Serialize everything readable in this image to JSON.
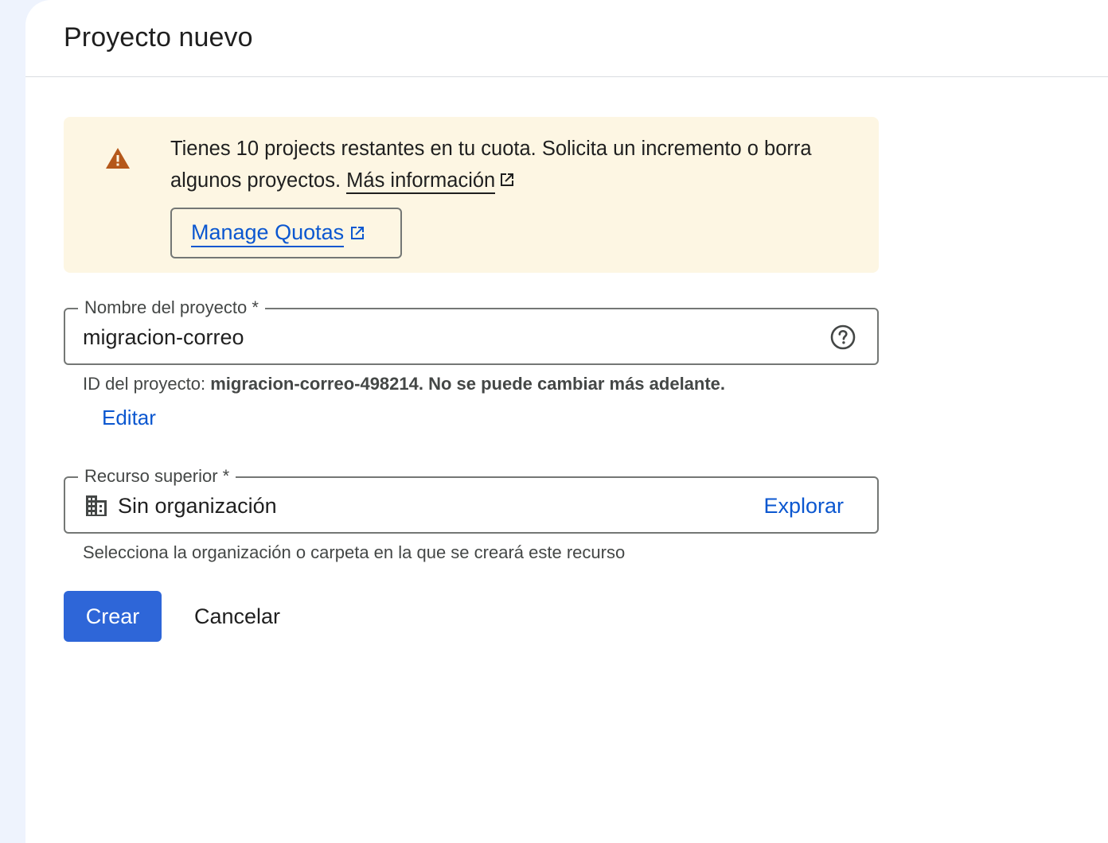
{
  "header": {
    "title": "Proyecto nuevo"
  },
  "banner": {
    "message": "Tienes 10 projects restantes en tu cuota. Solicita un incremento o borra algunos proyectos.",
    "more_info_link": "Más información",
    "manage_button": "Manage Quotas",
    "icon": "warning-icon",
    "accent_color": "#b5581a",
    "background_color": "#fdf6e3"
  },
  "project_name_field": {
    "label": "Nombre del proyecto *",
    "value": "migracion-correo",
    "icon": "help-icon"
  },
  "project_id_hint": {
    "prefix": "ID del proyecto:",
    "value": "migracion-correo-498214. No se puede cambiar más adelante.",
    "edit_link": "Editar"
  },
  "parent_resource_field": {
    "label": "Recurso superior *",
    "value": "Sin organización",
    "icon": "building-icon",
    "browse_link": "Explorar",
    "hint": "Selecciona la organización o carpeta en la que se creará este recurso"
  },
  "actions": {
    "create": "Crear",
    "cancel": "Cancelar",
    "primary_color": "#2e66d8"
  }
}
